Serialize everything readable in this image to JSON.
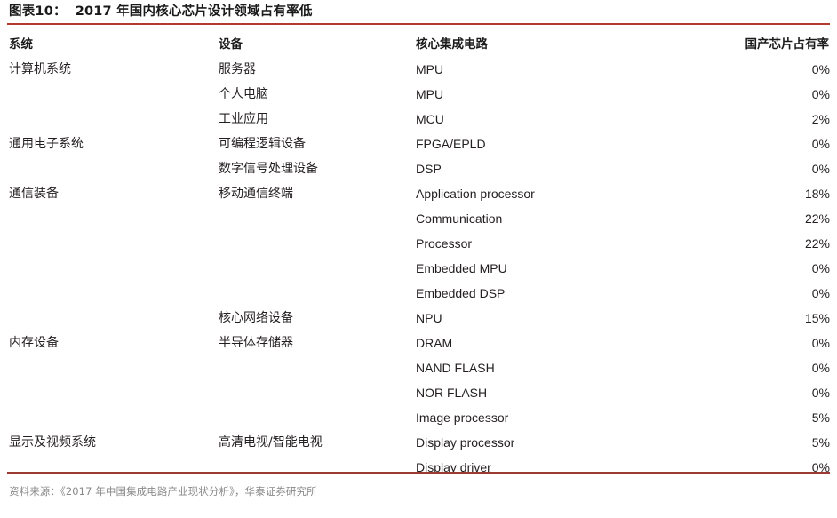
{
  "figure": {
    "label": "图表10：",
    "title": "2017 年国内核心芯片设计领域占有率低",
    "accent_color": "#b23a2e",
    "rule_bottom_color": "#9c3b33",
    "source_note": "资料来源：《2017 年中国集成电路产业现状分析》，华泰证券研究所"
  },
  "table": {
    "columns": [
      {
        "key": "system",
        "label": "系统",
        "align": "left"
      },
      {
        "key": "device",
        "label": "设备",
        "align": "left"
      },
      {
        "key": "ic",
        "label": "核心集成电路",
        "align": "left"
      },
      {
        "key": "share",
        "label": "国产芯片占有率",
        "align": "right"
      }
    ],
    "rows": [
      {
        "system": "计算机系统",
        "device": "服务器",
        "ic": "MPU",
        "share": "0%"
      },
      {
        "system": "",
        "device": "个人电脑",
        "ic": "MPU",
        "share": "0%"
      },
      {
        "system": "",
        "device": "工业应用",
        "ic": "MCU",
        "share": "2%"
      },
      {
        "system": "通用电子系统",
        "device": "可编程逻辑设备",
        "ic": "FPGA/EPLD",
        "share": "0%"
      },
      {
        "system": "",
        "device": "数字信号处理设备",
        "ic": "DSP",
        "share": "0%"
      },
      {
        "system": "通信装备",
        "device": "移动通信终端",
        "ic": "Application processor",
        "share": "18%"
      },
      {
        "system": "",
        "device": "",
        "ic": "Communication",
        "share": "22%"
      },
      {
        "system": "",
        "device": "",
        "ic": "Processor",
        "share": "22%"
      },
      {
        "system": "",
        "device": "",
        "ic": "Embedded MPU",
        "share": "0%"
      },
      {
        "system": "",
        "device": "",
        "ic": "Embedded DSP",
        "share": "0%"
      },
      {
        "system": "",
        "device": "核心网络设备",
        "ic": "NPU",
        "share": "15%"
      },
      {
        "system": "内存设备",
        "device": "半导体存储器",
        "ic": "DRAM",
        "share": "0%"
      },
      {
        "system": "",
        "device": "",
        "ic": "NAND FLASH",
        "share": "0%"
      },
      {
        "system": "",
        "device": "",
        "ic": "NOR FLASH",
        "share": "0%"
      },
      {
        "system": "",
        "device": "",
        "ic": "Image processor",
        "share": "5%"
      },
      {
        "system": "显示及视频系统",
        "device": "高清电视/智能电视",
        "ic": "Display processor",
        "share": "5%"
      },
      {
        "system": "",
        "device": "",
        "ic": "Display driver",
        "share": "0%"
      }
    ]
  },
  "chart_data": {
    "type": "table",
    "title": "2017 年国内核心芯片设计领域占有率低",
    "xlabel": "核心集成电路",
    "ylabel": "国产芯片占有率 (%)",
    "categories": [
      "MPU (服务器)",
      "MPU (个人电脑)",
      "MCU (工业应用)",
      "FPGA/EPLD",
      "DSP",
      "Application processor",
      "Communication",
      "Processor",
      "Embedded MPU",
      "Embedded DSP",
      "NPU",
      "DRAM",
      "NAND FLASH",
      "NOR FLASH",
      "Image processor",
      "Display processor",
      "Display driver"
    ],
    "values": [
      0,
      0,
      2,
      0,
      0,
      18,
      22,
      22,
      0,
      0,
      15,
      0,
      0,
      0,
      5,
      5,
      0
    ],
    "ylim": [
      0,
      25
    ],
    "grid": false,
    "legend": "none"
  }
}
